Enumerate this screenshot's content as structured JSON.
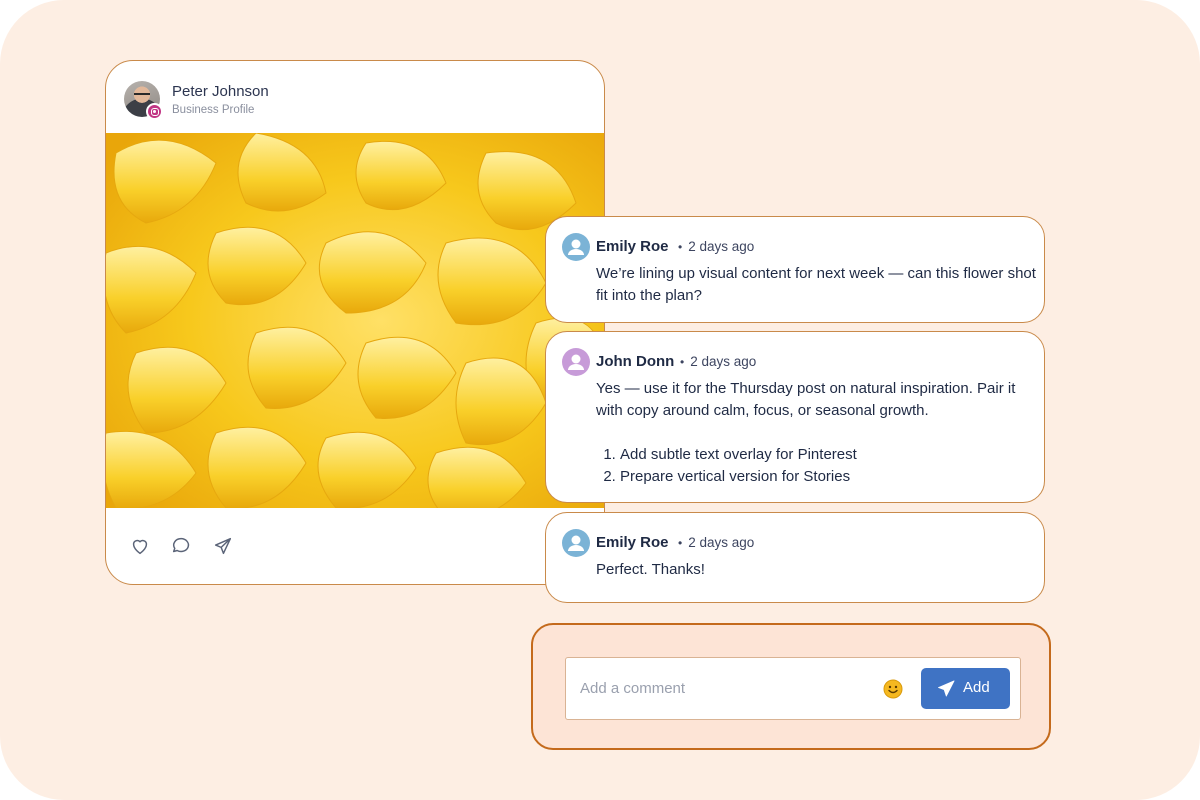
{
  "colors": {
    "background": "#fdeee3",
    "card_border": "#c98a4a",
    "composer_border": "#c46a1c",
    "composer_fill": "#fde4d6",
    "primary_button": "#3f73c4",
    "instagram": "#c13584",
    "emily_avatar": "#7bb3d6",
    "john_avatar": "#c79bd8"
  },
  "post": {
    "author": "Peter Johnson",
    "subtitle": "Business Profile",
    "platform_icon": "instagram-icon",
    "image": "yellow-flower-macro-photo",
    "actions": [
      {
        "name": "like",
        "icon": "heart-icon"
      },
      {
        "name": "comment",
        "icon": "comment-icon"
      },
      {
        "name": "share",
        "icon": "send-icon"
      }
    ]
  },
  "comments": [
    {
      "author": "Emily Roe",
      "time": "2 days ago",
      "text": "We’re lining up visual content for next week — can this flower shot fit into the plan?"
    },
    {
      "author": "John Donn",
      "time": "2 days ago",
      "text": "Yes — use it for the Thursday post on natural inspiration. Pair it with copy around calm, focus, or seasonal growth.",
      "list": [
        "Add subtle text overlay for Pinterest",
        "Prepare vertical version for Stories"
      ]
    },
    {
      "author": "Emily Roe",
      "time": "2 days ago",
      "text": "Perfect. Thanks!"
    }
  ],
  "composer": {
    "placeholder": "Add a comment",
    "value": "",
    "emoji_icon": "smiley-emoji-icon",
    "button_label": "Add",
    "button_icon": "paper-plane-icon"
  }
}
